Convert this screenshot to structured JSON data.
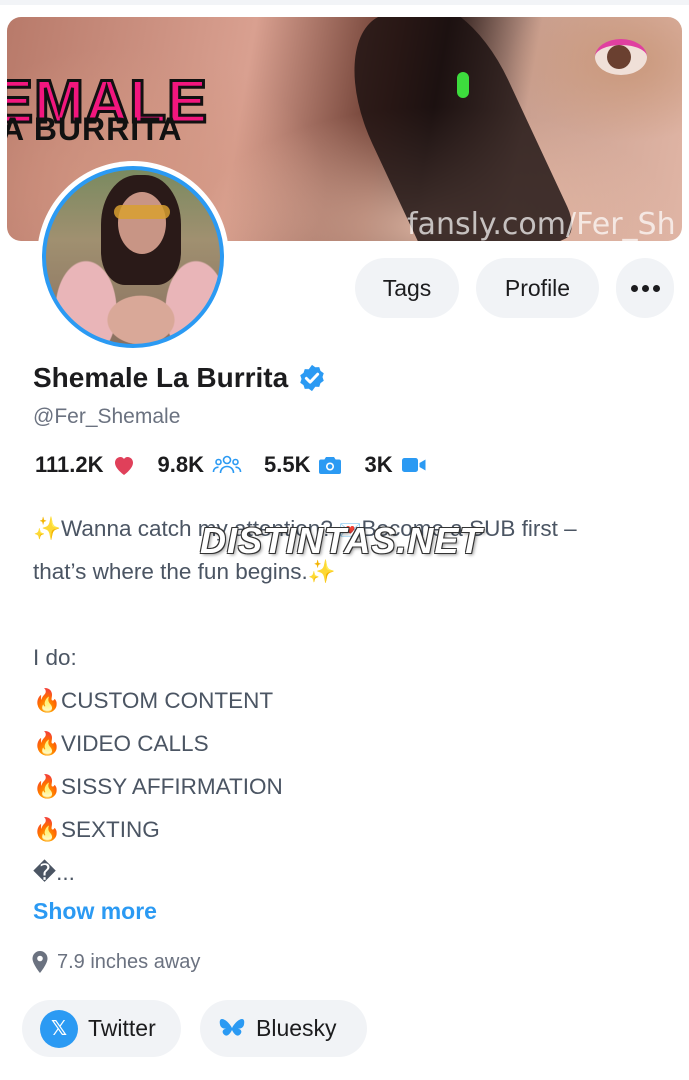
{
  "banner": {
    "title_line1": "EMALE",
    "title_line2": "A BURRITA",
    "watermark": "fansly.com/Fer_Sh"
  },
  "actions": {
    "tags_label": "Tags",
    "profile_label": "Profile",
    "more_icon": "more-dots-icon"
  },
  "profile": {
    "display_name": "Shemale La Burrita",
    "handle": "@Fer_Shemale",
    "verified": true
  },
  "stats": [
    {
      "value": "111.2K",
      "icon": "heart-icon"
    },
    {
      "value": "9.8K",
      "icon": "subscribers-icon"
    },
    {
      "value": "5.5K",
      "icon": "camera-icon"
    },
    {
      "value": "3K",
      "icon": "video-icon"
    }
  ],
  "bio": {
    "line1_a": "Wanna catch my attention? ",
    "line1_b": "Become a SUB first –",
    "line2": "that’s where the fun begins.",
    "line3": "I do:",
    "items": [
      "CUSTOM CONTENT",
      "VIDEO CALLS",
      "SISSY AFFIRMATION",
      "SEXTING"
    ],
    "truncated": "�..."
  },
  "overlay_watermark": "DISTINTAS.NET",
  "show_more_label": "Show more",
  "location": "7.9 inches away",
  "socials": [
    {
      "label": "Twitter",
      "icon": "x-icon"
    },
    {
      "label": "Bluesky",
      "icon": "bluesky-icon"
    }
  ],
  "colors": {
    "accent": "#2b9af3",
    "heart": "#e0405a",
    "pill_bg": "#f1f3f6"
  }
}
